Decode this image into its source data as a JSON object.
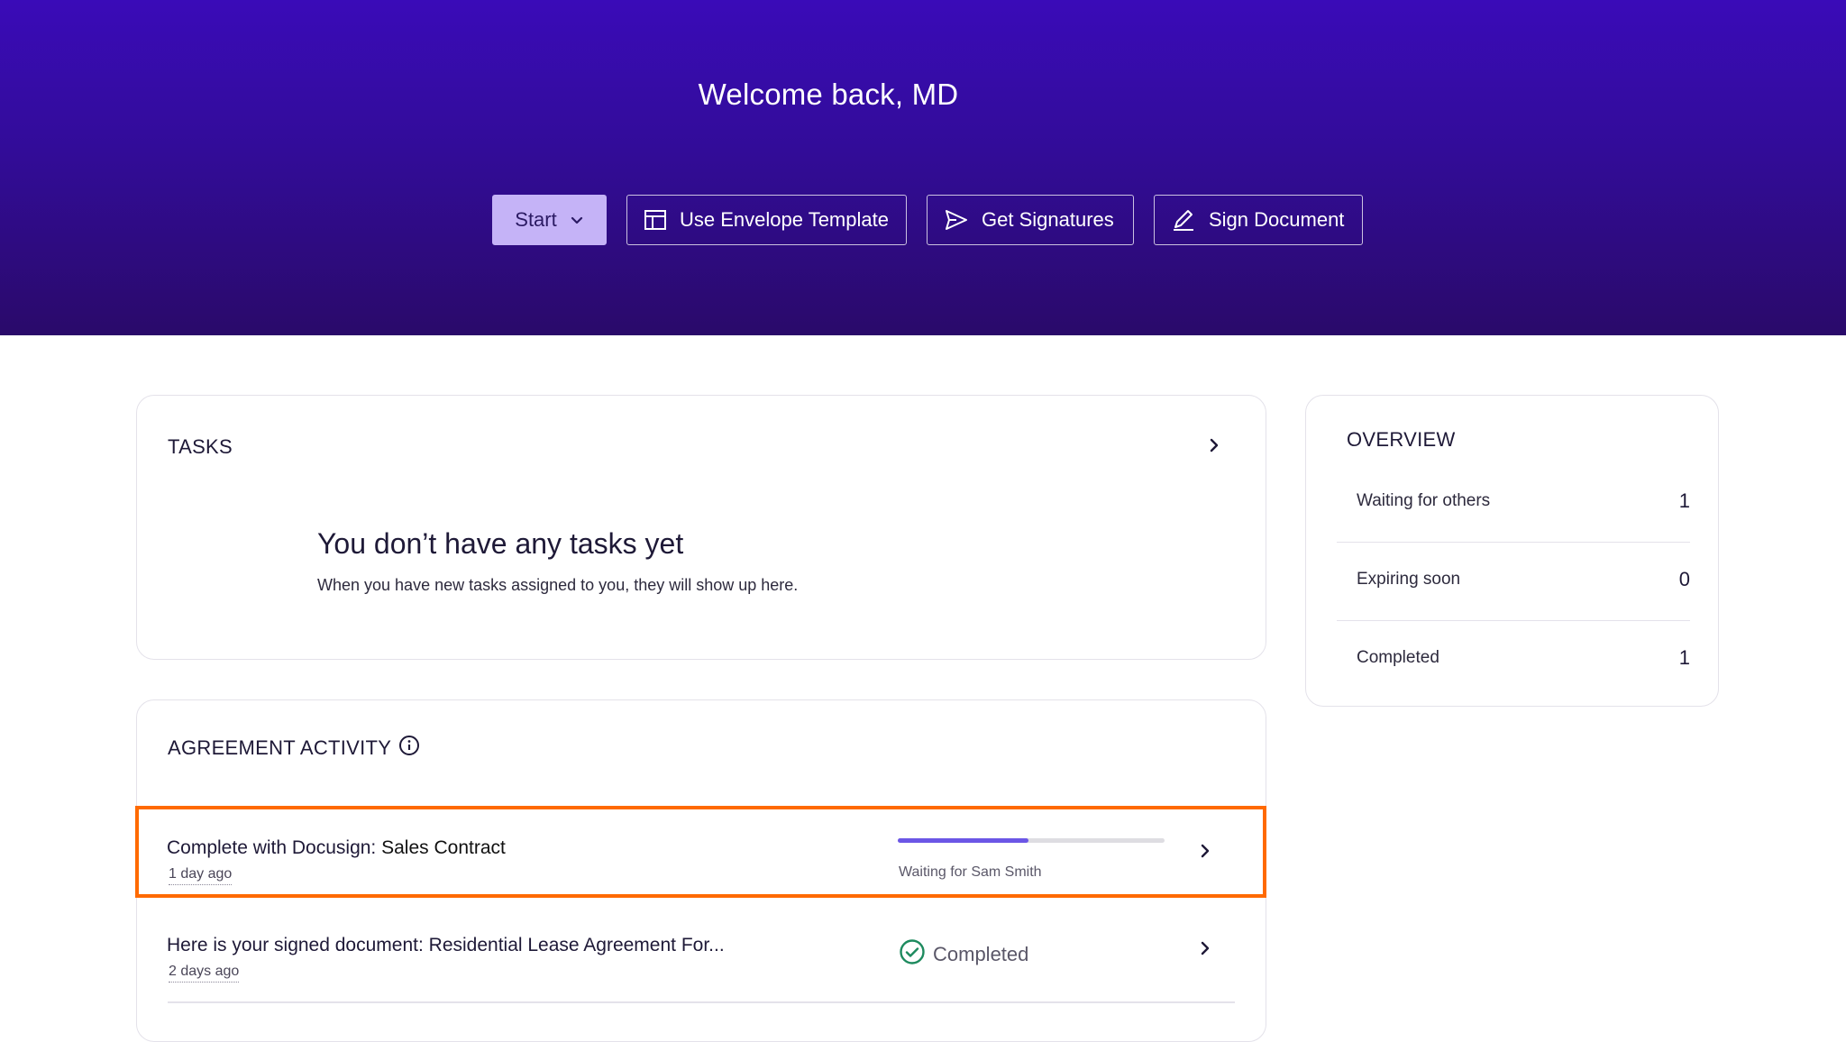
{
  "hero": {
    "title": "Welcome back, MD",
    "actions": {
      "start": "Start",
      "use_template": "Use Envelope Template",
      "get_signatures": "Get Signatures",
      "sign_document": "Sign Document"
    }
  },
  "tasks": {
    "heading": "TASKS",
    "empty_title": "You don’t have any tasks yet",
    "empty_subtitle": "When you have new tasks assigned to you, they will show up here."
  },
  "activity": {
    "heading": "AGREEMENT ACTIVITY",
    "rows": [
      {
        "title_prefix": "Complete with Docusign: ",
        "title_doc": "Sales Contract",
        "time": "1 day ago",
        "status": "Waiting for Sam Smith",
        "progress": 0.49
      },
      {
        "title": "Here is your signed document: Residential Lease Agreement For...",
        "time": "2 days ago",
        "status": "Completed"
      }
    ]
  },
  "overview": {
    "heading": "OVERVIEW",
    "items": [
      {
        "label": "Waiting for others",
        "value": "1"
      },
      {
        "label": "Expiring soon",
        "value": "0"
      },
      {
        "label": "Completed",
        "value": "1"
      }
    ]
  },
  "colors": {
    "hero_top": "#3a0bb8",
    "hero_bottom": "#2a0a6a",
    "start_button": "#c5b3f7",
    "progress_fill": "#6b56e6",
    "completed_check": "#1d8a5e",
    "highlight": "#ff6a00"
  }
}
